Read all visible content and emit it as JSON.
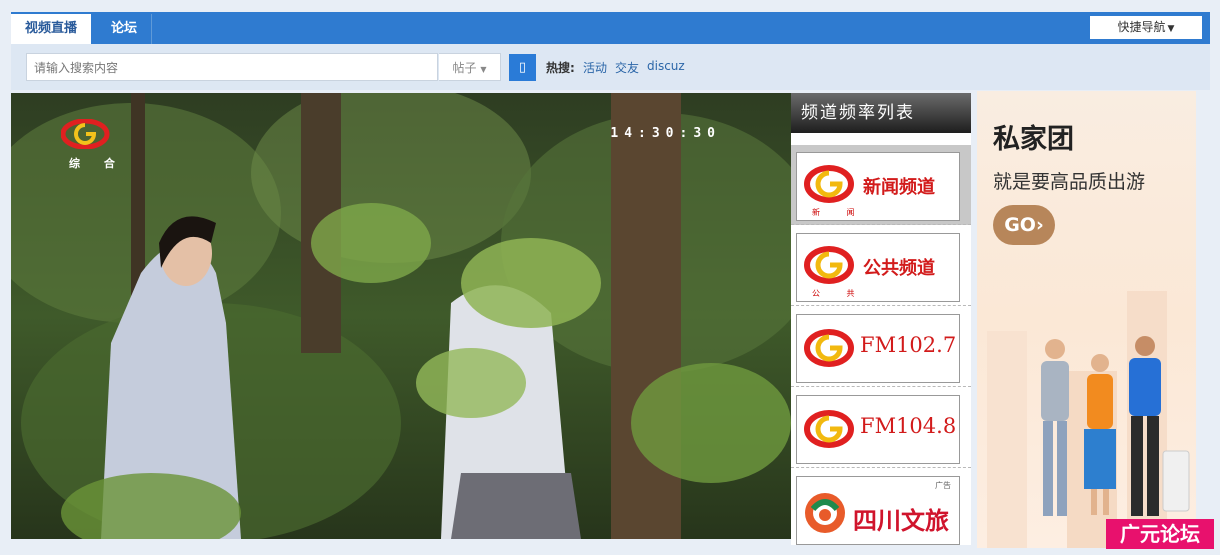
{
  "nav": {
    "tabs": [
      {
        "label": "视频直播",
        "active": true
      },
      {
        "label": "论坛",
        "active": false
      }
    ],
    "quick_nav_label": "快捷导航"
  },
  "search": {
    "placeholder": "请输入搜索内容",
    "type_selected": "帖子",
    "hot_label": "热搜:",
    "hot_links": [
      "活动",
      "交友",
      "discuz"
    ]
  },
  "player": {
    "channel_logo_label": "综 合",
    "clock": "14:30:30"
  },
  "channels": {
    "header": "频道频率列表",
    "items": [
      {
        "label": "新闻频道",
        "sub": "新 闻",
        "active": true
      },
      {
        "label": "公共频道",
        "sub": "公 共",
        "active": false
      },
      {
        "label": "FM102.7",
        "sub": "",
        "active": false
      },
      {
        "label": "FM104.8",
        "sub": "",
        "active": false
      }
    ],
    "ad": {
      "tag": "广告",
      "label": "四川文旅"
    }
  },
  "side_ad": {
    "title": "私家团",
    "subtitle": "就是要高品质出游",
    "button": "GO"
  },
  "watermark": "广元论坛",
  "colors": {
    "nav_blue": "#2f7bd0",
    "channel_red": "#d21b1b",
    "brand_pink": "#e8116d"
  }
}
